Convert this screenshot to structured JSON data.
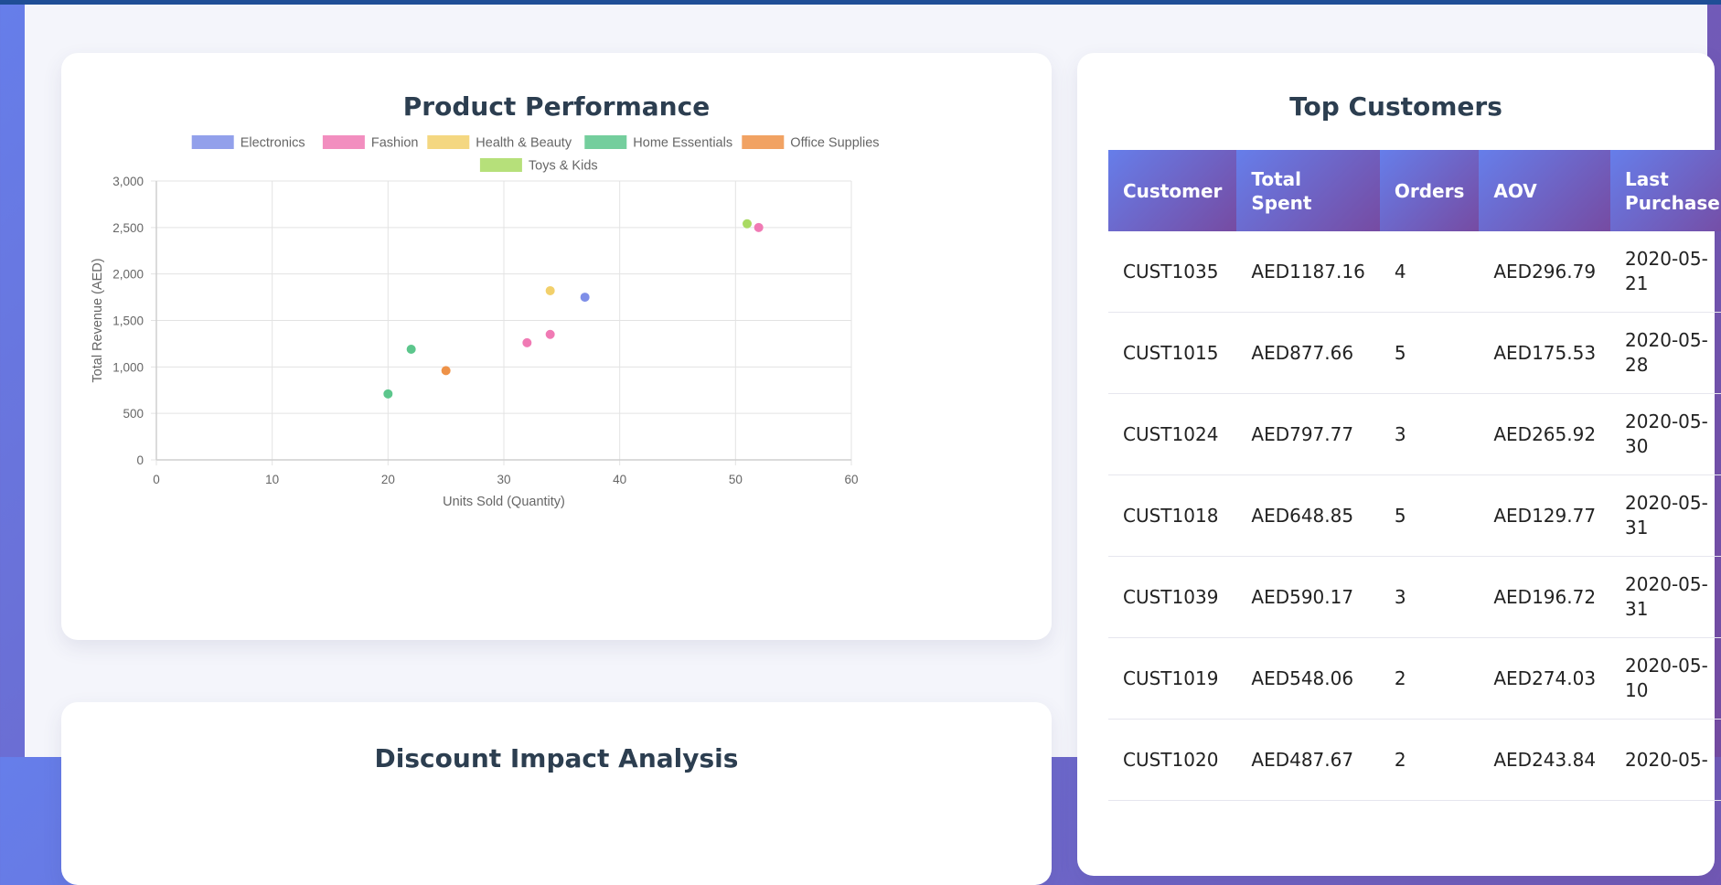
{
  "product_card": {
    "title": "Product Performance"
  },
  "discount_card": {
    "title": "Discount Impact Analysis"
  },
  "customers_card": {
    "title": "Top Customers",
    "columns": [
      "Customer",
      "Total Spent",
      "Orders",
      "AOV",
      "Last Purchase"
    ],
    "rows": [
      [
        "CUST1035",
        "AED1187.16",
        "4",
        "AED296.79",
        "2020-05-21"
      ],
      [
        "CUST1015",
        "AED877.66",
        "5",
        "AED175.53",
        "2020-05-28"
      ],
      [
        "CUST1024",
        "AED797.77",
        "3",
        "AED265.92",
        "2020-05-30"
      ],
      [
        "CUST1018",
        "AED648.85",
        "5",
        "AED129.77",
        "2020-05-31"
      ],
      [
        "CUST1039",
        "AED590.17",
        "3",
        "AED196.72",
        "2020-05-31"
      ],
      [
        "CUST1019",
        "AED548.06",
        "2",
        "AED274.03",
        "2020-05-10"
      ],
      [
        "CUST1020",
        "AED487.67",
        "2",
        "AED243.84",
        "2020-05-"
      ]
    ]
  },
  "chart_data": {
    "type": "scatter",
    "xlabel": "Units Sold (Quantity)",
    "ylabel": "Total Revenue (AED)",
    "xlim": [
      0,
      60
    ],
    "ylim": [
      0,
      3000
    ],
    "xticks": [
      "0",
      "10",
      "20",
      "30",
      "40",
      "50",
      "60"
    ],
    "yticks": [
      "0",
      "500",
      "1,000",
      "1,500",
      "2,000",
      "2,500",
      "3,000"
    ],
    "grid": true,
    "legend_position": "top-center",
    "series": [
      {
        "name": "Electronics",
        "color": "#7f8fe8",
        "points": [
          [
            37,
            1750
          ]
        ]
      },
      {
        "name": "Fashion",
        "color": "#f07ab4",
        "points": [
          [
            52,
            2500
          ],
          [
            34,
            1350
          ],
          [
            32,
            1260
          ]
        ]
      },
      {
        "name": "Health & Beauty",
        "color": "#f2d06b",
        "points": [
          [
            34,
            1820
          ]
        ]
      },
      {
        "name": "Home Essentials",
        "color": "#5cc68c",
        "points": [
          [
            22,
            1190
          ],
          [
            20,
            710
          ]
        ]
      },
      {
        "name": "Office Supplies",
        "color": "#ee9248",
        "points": [
          [
            25,
            960
          ]
        ]
      },
      {
        "name": "Toys & Kids",
        "color": "#a9da63",
        "points": [
          [
            51,
            2540
          ]
        ]
      }
    ]
  }
}
